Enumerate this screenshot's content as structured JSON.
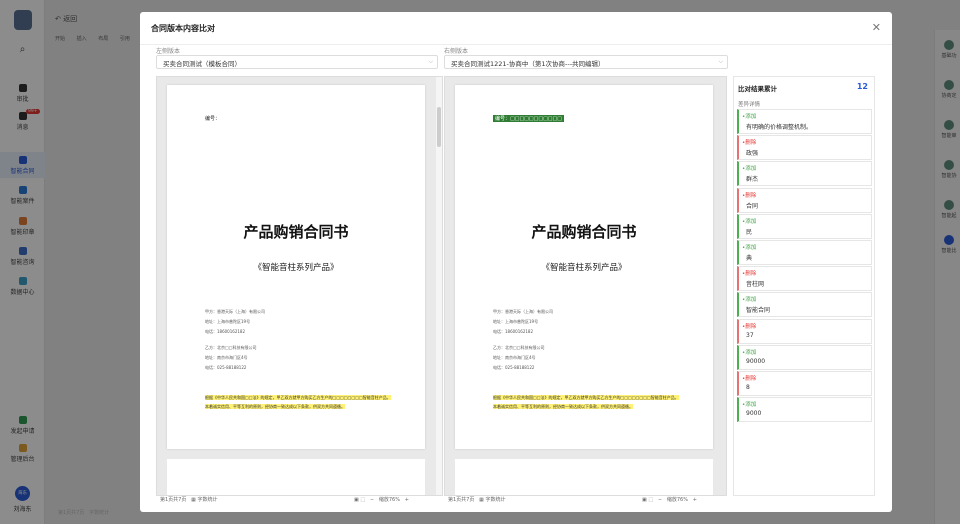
{
  "app": {
    "back_label": "返回",
    "toolbar_items": [
      "开始",
      "插入",
      "布局",
      "引用"
    ],
    "status_left": "第1页共7页",
    "status_word_count": "字数统计"
  },
  "nav": {
    "search_icon": "search-icon",
    "items": [
      {
        "label": "审批"
      },
      {
        "label": "消息",
        "badge": "99+"
      },
      {
        "label": "智能合同"
      },
      {
        "label": "智能案件"
      },
      {
        "label": "智能印章"
      },
      {
        "label": "智能咨询"
      },
      {
        "label": "数据中心"
      },
      {
        "label": "发起申请"
      },
      {
        "label": "管理后台"
      }
    ],
    "user_avatar": "海东",
    "user_name": "刘海东"
  },
  "right_rail": {
    "items": [
      "基础功",
      "协商定",
      "智能审",
      "智能协",
      "智能起",
      "智能比"
    ],
    "labels_partial": [
      "已选",
      "已选"
    ]
  },
  "modal": {
    "title": "合同版本内容比对",
    "close_icon": "close-icon",
    "left_label": "左侧版本",
    "left_value": "买卖合同测试（模板合同）",
    "right_label": "右侧版本",
    "right_value": "买卖合同测试1221-协商中（第1次协商---共同编辑）",
    "left_doc": {
      "tag": "编号：",
      "title": "产品购销合同书",
      "subtitle": "《智能音柱系列产品》",
      "lines": [
        "甲方：香港天际（上海）有限公司",
        "地址：上海市普陀区19号",
        "电话：18600162182",
        "乙方：北京□□科技有限公司",
        "地址：南京市海门区4号",
        "电话：025-88188122"
      ],
      "para": "根据《中华人民共和国□□法》的规定，甲乙双方就甲方购买乙方生产的□□□□□□□□智能音柱产品，本着诚实信用、平等互利的原则，经协商一致达成以下条款，供双方共同遵循。"
    },
    "right_doc": {
      "tag": "编号：□□□□□□□□□□□",
      "title": "产品购销合同书",
      "subtitle": "《智能音柱系列产品》",
      "lines": [
        "甲方：香港天际（上海）有限公司",
        "地址：上海市普陀区19号",
        "电话：18600162182",
        "乙方：北京□□科技有限公司",
        "地址：南京市海门区4号",
        "电话：025-88188122"
      ],
      "para": "根据《中华人民共和国□□法》的规定，甲乙双方就甲方购买乙方生产的□□□□□□□□智能音柱产品，本着诚实信用、平等互利的原则，经协商一致达成以下条款，供双方共同遵循。"
    },
    "left_status": {
      "page": "第1页共7页",
      "wordcount": "字数统计",
      "zoom": "缩放76%"
    },
    "right_status": {
      "page": "第1页共7页",
      "wordcount": "字数统计",
      "zoom": "缩放76%"
    },
    "result": {
      "title": "比对结果累计",
      "count": "12",
      "subtitle": "差异详情",
      "items": [
        {
          "type": "•添加",
          "kind": "add",
          "text": "有明确的价格调整机制。"
        },
        {
          "type": "•删除",
          "kind": "del",
          "text": "政强"
        },
        {
          "type": "•添加",
          "kind": "add",
          "text": "群杰"
        },
        {
          "type": "•删除",
          "kind": "del",
          "text": "合同"
        },
        {
          "type": "•添加",
          "kind": "add",
          "text": "民"
        },
        {
          "type": "•添加",
          "kind": "add",
          "text": "典"
        },
        {
          "type": "•删除",
          "kind": "del",
          "text": "音柱网"
        },
        {
          "type": "•添加",
          "kind": "add",
          "text": "智能合同"
        },
        {
          "type": "•删除",
          "kind": "del",
          "text": "37"
        },
        {
          "type": "•添加",
          "kind": "add",
          "text": "90000"
        },
        {
          "type": "•删除",
          "kind": "del",
          "text": "8"
        },
        {
          "type": "•添加",
          "kind": "add",
          "text": "9000"
        }
      ]
    }
  }
}
